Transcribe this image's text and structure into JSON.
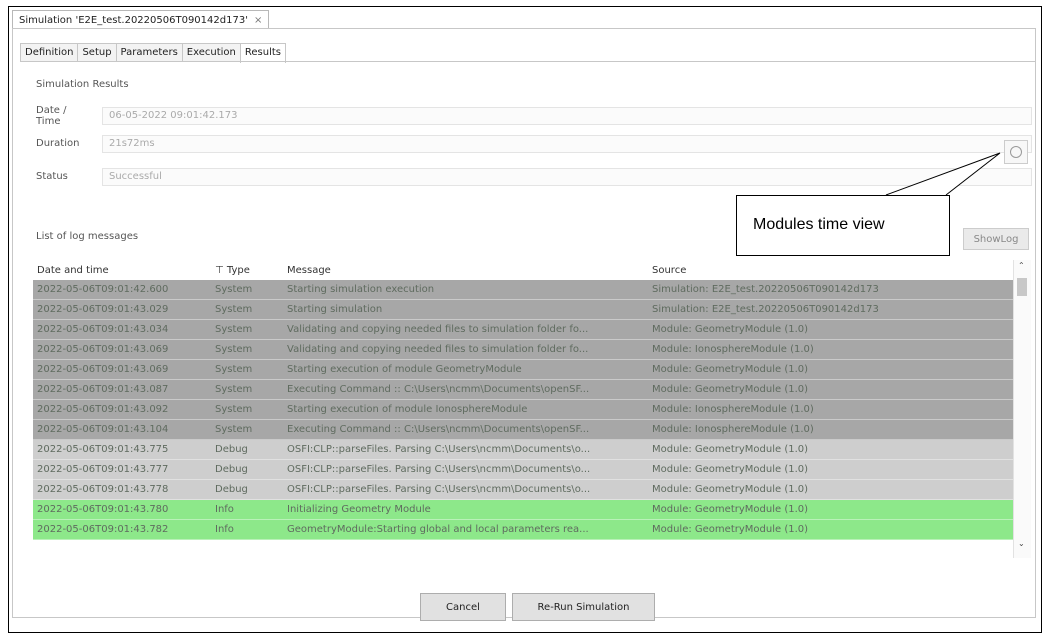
{
  "editor_tab": {
    "title": "Simulation 'E2E_test.20220506T090142d173'",
    "close": "×"
  },
  "tabs": [
    "Definition",
    "Setup",
    "Parameters",
    "Execution",
    "Results"
  ],
  "results": {
    "title": "Simulation Results",
    "date_label": "Date / Time",
    "date_value": "06-05-2022 09:01:42.173",
    "duration_label": "Duration",
    "duration_value": "21s72ms",
    "status_label": "Status",
    "status_value": "Successful"
  },
  "callout": {
    "text": "Modules time view"
  },
  "log": {
    "title": "List of log messages",
    "show_log": "ShowLog",
    "columns": {
      "date": "Date and time",
      "type": "Type",
      "message": "Message",
      "source": "Source",
      "filter_icon": "⊤"
    },
    "rows": [
      {
        "date": "2022-05-06T09:01:42.600",
        "type": "System",
        "message": "Starting simulation execution",
        "source": "Simulation: E2E_test.20220506T090142d173",
        "kind": "system"
      },
      {
        "date": "2022-05-06T09:01:43.029",
        "type": "System",
        "message": "Starting simulation",
        "source": "Simulation: E2E_test.20220506T090142d173",
        "kind": "system"
      },
      {
        "date": "2022-05-06T09:01:43.034",
        "type": "System",
        "message": "Validating and copying needed files to simulation folder fo...",
        "source": "Module: GeometryModule (1.0)",
        "kind": "system"
      },
      {
        "date": "2022-05-06T09:01:43.069",
        "type": "System",
        "message": "Validating and copying needed files to simulation folder fo...",
        "source": "Module: IonosphereModule (1.0)",
        "kind": "system"
      },
      {
        "date": "2022-05-06T09:01:43.069",
        "type": "System",
        "message": "Starting execution of module GeometryModule",
        "source": "Module: GeometryModule (1.0)",
        "kind": "system"
      },
      {
        "date": "2022-05-06T09:01:43.087",
        "type": "System",
        "message": "Executing Command :: C:\\Users\\ncmm\\Documents\\openSF...",
        "source": "Module: GeometryModule (1.0)",
        "kind": "system"
      },
      {
        "date": "2022-05-06T09:01:43.092",
        "type": "System",
        "message": "Starting execution of module IonosphereModule",
        "source": "Module: IonosphereModule (1.0)",
        "kind": "system"
      },
      {
        "date": "2022-05-06T09:01:43.104",
        "type": "System",
        "message": "Executing Command :: C:\\Users\\ncmm\\Documents\\openSF...",
        "source": "Module: IonosphereModule (1.0)",
        "kind": "system"
      },
      {
        "date": "2022-05-06T09:01:43.775",
        "type": "Debug",
        "message": "OSFI:CLP::parseFiles. Parsing C:\\Users\\ncmm\\Documents\\o...",
        "source": "Module: GeometryModule (1.0)",
        "kind": "debug"
      },
      {
        "date": "2022-05-06T09:01:43.777",
        "type": "Debug",
        "message": "OSFI:CLP::parseFiles. Parsing C:\\Users\\ncmm\\Documents\\o...",
        "source": "Module: GeometryModule (1.0)",
        "kind": "debug"
      },
      {
        "date": "2022-05-06T09:01:43.778",
        "type": "Debug",
        "message": "OSFI:CLP::parseFiles. Parsing C:\\Users\\ncmm\\Documents\\o...",
        "source": "Module: GeometryModule (1.0)",
        "kind": "debug"
      },
      {
        "date": "2022-05-06T09:01:43.780",
        "type": "Info",
        "message": "Initializing Geometry Module",
        "source": "Module: GeometryModule (1.0)",
        "kind": "info"
      },
      {
        "date": "2022-05-06T09:01:43.782",
        "type": "Info",
        "message": "GeometryModule:Starting global and local parameters rea...",
        "source": "Module: GeometryModule (1.0)",
        "kind": "info"
      }
    ]
  },
  "buttons": {
    "cancel": "Cancel",
    "rerun": "Re-Run Simulation"
  },
  "colors": {
    "system_row": "#a7a7a7",
    "debug_row": "#cecece",
    "info_row": "#8de88a"
  }
}
